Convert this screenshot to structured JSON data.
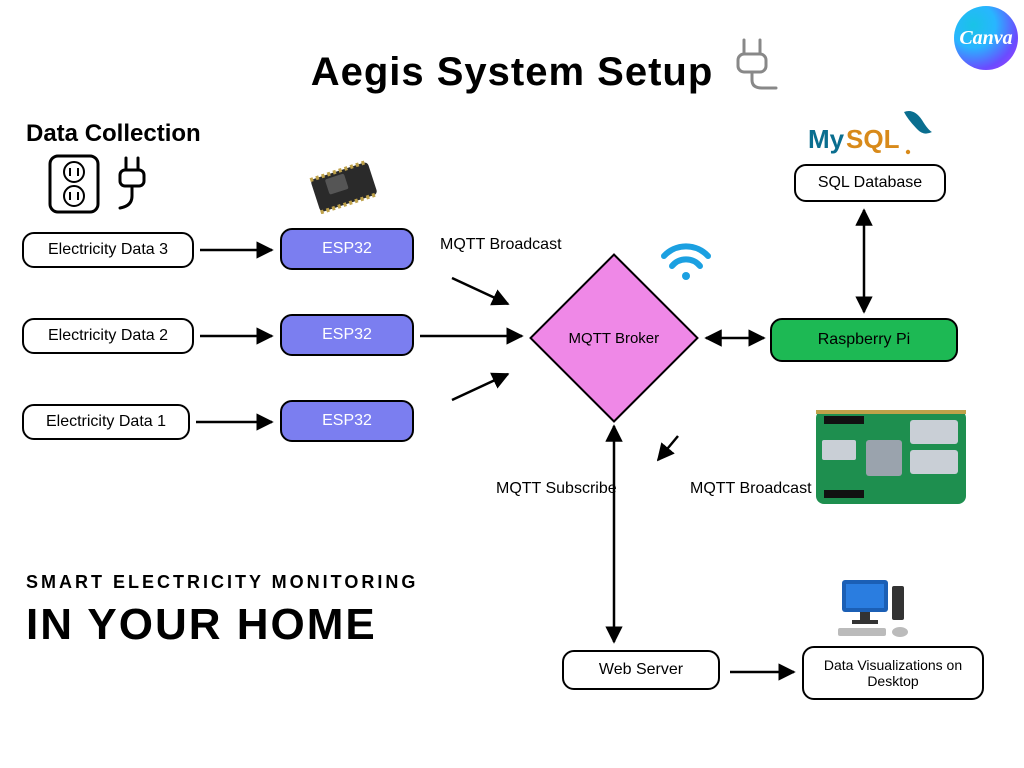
{
  "title": "Aegis System Setup",
  "section_label": "Data Collection",
  "data_sources": [
    {
      "label": "Electricity Data 3"
    },
    {
      "label": "Electricity Data 2"
    },
    {
      "label": "Electricity Data 1"
    }
  ],
  "esp_nodes": [
    {
      "label": "ESP32"
    },
    {
      "label": "ESP32"
    },
    {
      "label": "ESP32"
    }
  ],
  "broker": {
    "label": "MQTT Broker"
  },
  "rpi": {
    "label": "Raspberry Pi"
  },
  "sql": {
    "label": "SQL Database"
  },
  "webserver": {
    "label": "Web Server"
  },
  "dataviz": {
    "label": "Data Visualizations on Desktop"
  },
  "edge_labels": {
    "broadcast_top": "MQTT Broadcast",
    "subscribe": "MQTT Subscribe",
    "broadcast_bottom": "MQTT Broadcast"
  },
  "tagline": {
    "small": "SMART ELECTRICITY MONITORING",
    "big": "IN YOUR HOME"
  },
  "logos": {
    "mysql": "MySQL",
    "canva": "Canva"
  },
  "icons": {
    "plug_title": "plug-icon",
    "outlet": "outlet-icon",
    "mini_plug": "plug-icon",
    "esp_board": "microcontroller-icon",
    "wifi": "wifi-icon",
    "rpi_board": "raspberry-pi-board-icon",
    "desktop": "desktop-computer-icon",
    "mysql_dolphin": "mysql-dolphin-icon"
  }
}
